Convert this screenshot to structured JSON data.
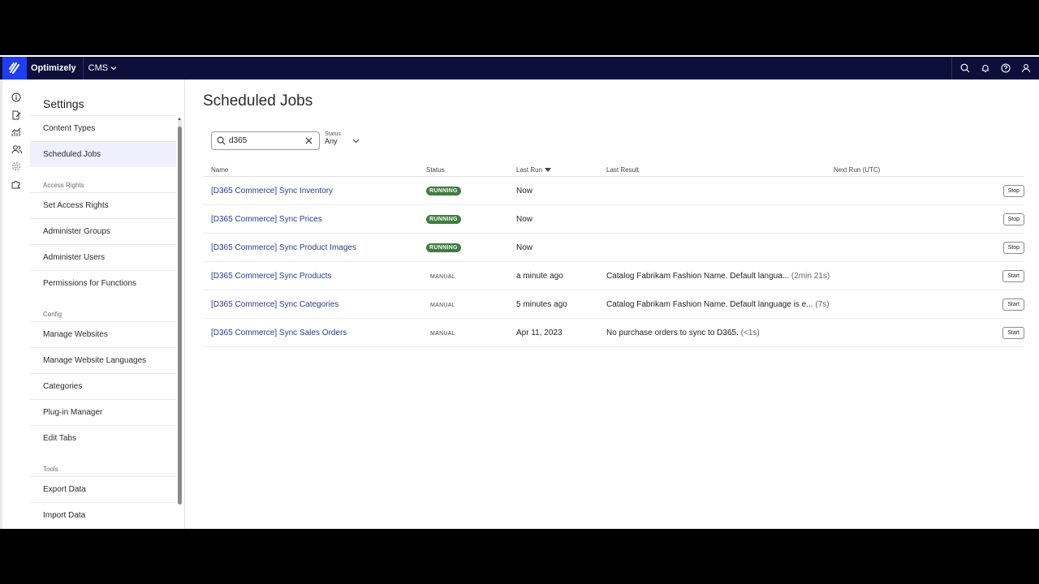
{
  "topbar": {
    "brand": "Optimizely",
    "product": "CMS"
  },
  "sidebar": {
    "title": "Settings",
    "items": [
      {
        "type": "item",
        "label": "Content Types"
      },
      {
        "type": "item",
        "label": "Scheduled Jobs",
        "active": true
      },
      {
        "type": "group",
        "label": "Access Rights"
      },
      {
        "type": "item",
        "label": "Set Access Rights"
      },
      {
        "type": "item",
        "label": "Administer Groups"
      },
      {
        "type": "item",
        "label": "Administer Users"
      },
      {
        "type": "item",
        "label": "Permissions for Functions"
      },
      {
        "type": "group",
        "label": "Config"
      },
      {
        "type": "item",
        "label": "Manage Websites"
      },
      {
        "type": "item",
        "label": "Manage Website Languages"
      },
      {
        "type": "item",
        "label": "Categories"
      },
      {
        "type": "item",
        "label": "Plug-in Manager"
      },
      {
        "type": "item",
        "label": "Edit Tabs"
      },
      {
        "type": "group",
        "label": "Tools"
      },
      {
        "type": "item",
        "label": "Export Data"
      },
      {
        "type": "item",
        "label": "Import Data"
      }
    ]
  },
  "main": {
    "title": "Scheduled Jobs",
    "search": {
      "value": "d365"
    },
    "status_filter": {
      "label": "Status",
      "value": "Any"
    },
    "columns": {
      "name": "Name",
      "status": "Status",
      "last_run": "Last Run",
      "last_result": "Last Result",
      "next_run": "Next Run (UTC)"
    },
    "rows": [
      {
        "name": "[D365 Commerce] Sync Inventory",
        "status": "RUNNING",
        "last_run": "Now",
        "result": "",
        "duration": "",
        "action": "Stop"
      },
      {
        "name": "[D365 Commerce] Sync Prices",
        "status": "RUNNING",
        "last_run": "Now",
        "result": "",
        "duration": "",
        "action": "Stop"
      },
      {
        "name": "[D365 Commerce] Sync Product Images",
        "status": "RUNNING",
        "last_run": "Now",
        "result": "",
        "duration": "",
        "action": "Stop"
      },
      {
        "name": "[D365 Commerce] Sync Products",
        "status": "MANUAL",
        "last_run": "a minute ago",
        "result": "Catalog Fabrikam Fashion Name. Default langua...",
        "duration": "(2min 21s)",
        "action": "Start"
      },
      {
        "name": "[D365 Commerce] Sync Categories",
        "status": "MANUAL",
        "last_run": "5 minutes ago",
        "result": "Catalog Fabrikam Fashion Name. Default language is e...",
        "duration": "(7s)",
        "action": "Start"
      },
      {
        "name": "[D365 Commerce] Sync Sales Orders",
        "status": "MANUAL",
        "last_run": "Apr 11, 2023",
        "result": "No purchase orders to sync to D365.",
        "duration": "(<1s)",
        "action": "Start"
      }
    ]
  },
  "colors": {
    "topbar": "#0b0f3a",
    "logo": "#1f3df2",
    "running": "#3f7d3f",
    "link": "#2a3b8f"
  }
}
